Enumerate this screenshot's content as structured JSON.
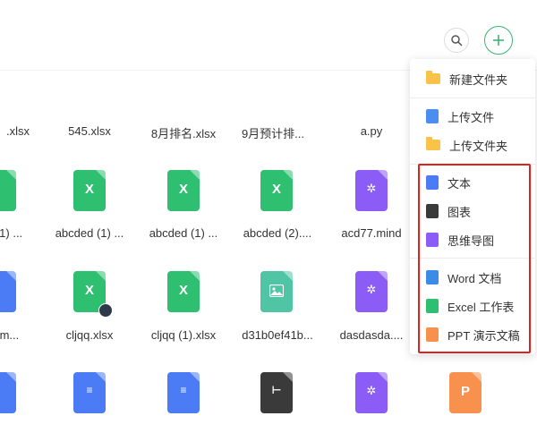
{
  "header": {
    "search_icon": "search-icon",
    "add_icon": "plus-icon"
  },
  "files": {
    "row1": [
      ".xlsx",
      "545.xlsx",
      "8月排名.xlsx",
      "9月预计排...",
      "a.py"
    ],
    "row2": [
      "(1) ...",
      "abcded (1) ...",
      "abcded (1) ...",
      "abcded (2)....",
      "acd77.mind"
    ],
    "row3": [
      "d.m...",
      "cljqq.xlsx",
      "cljqq (1).xlsx",
      "d31b0ef41b...",
      "dasdasda...."
    ]
  },
  "menu": {
    "new_folder": "新建文件夹",
    "upload_file": "上传文件",
    "upload_folder": "上传文件夹",
    "text": "文本",
    "chart": "图表",
    "mindmap": "思维导图",
    "word": "Word 文档",
    "excel": "Excel 工作表",
    "ppt": "PPT 演示文稿"
  },
  "colors": {
    "excel": "#2fbf71",
    "mind": "#8b5cf6",
    "doc": "#4b7cf5",
    "image": "#4fc5a6",
    "dark": "#3a3a3a",
    "ppt": "#f7914d",
    "folder": "#f9c34a",
    "accent": "#3cb371",
    "highlight": "#e0211b"
  }
}
